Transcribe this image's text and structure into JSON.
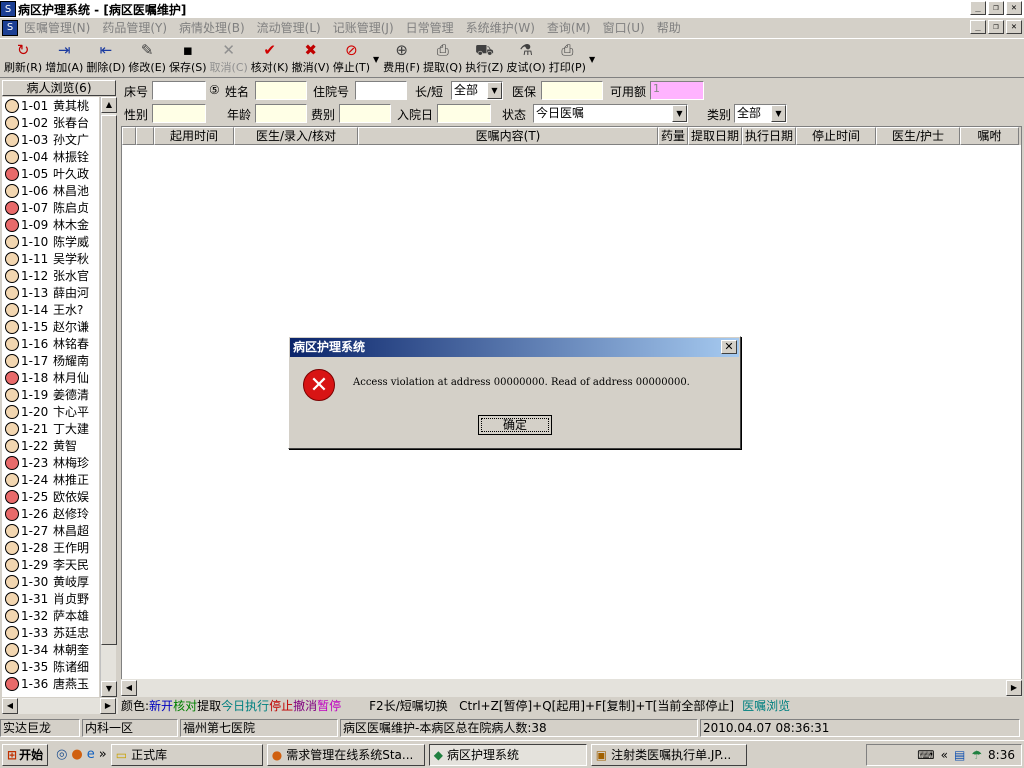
{
  "window": {
    "title": "病区护理系统 - [病区医嘱维护]"
  },
  "menu": [
    "医嘱管理(N)",
    "药品管理(Y)",
    "病情处理(B)",
    "流动管理(L)",
    "记账管理(J)",
    "日常管理",
    "系统维护(W)",
    "查询(M)",
    "窗口(U)",
    "帮助"
  ],
  "toolbar": [
    {
      "label": "刷新(R)",
      "icon": "refresh-icon",
      "glyph": "↻",
      "color": "#c00000",
      "disabled": false
    },
    {
      "label": "增加(A)",
      "icon": "add-icon",
      "glyph": "⇥",
      "color": "#1a3aa0",
      "disabled": false
    },
    {
      "label": "删除(D)",
      "icon": "delete-icon",
      "glyph": "⇤",
      "color": "#1a3aa0",
      "disabled": false
    },
    {
      "label": "修改(E)",
      "icon": "edit-icon",
      "glyph": "✎",
      "color": "#404040",
      "disabled": false
    },
    {
      "label": "保存(S)",
      "icon": "save-icon",
      "glyph": "▪",
      "color": "#000000",
      "disabled": false
    },
    {
      "label": "取消(C)",
      "icon": "cancel-icon",
      "glyph": "✕",
      "color": "#909090",
      "disabled": true
    },
    {
      "label": "核对(K)",
      "icon": "check-icon",
      "glyph": "✔",
      "color": "#d00000",
      "disabled": false
    },
    {
      "label": "撤消(V)",
      "icon": "undo-icon",
      "glyph": "✖",
      "color": "#c00000",
      "disabled": false
    },
    {
      "label": "停止(T)",
      "icon": "stop-icon",
      "glyph": "⊘",
      "color": "#d00000",
      "disabled": false
    },
    {
      "label": "费用(F)",
      "icon": "fee-icon",
      "glyph": "⊕",
      "color": "#404040",
      "disabled": false
    },
    {
      "label": "提取(Q)",
      "icon": "extract-icon",
      "glyph": "⎙",
      "color": "#404040",
      "disabled": false
    },
    {
      "label": "执行(Z)",
      "icon": "execute-icon",
      "glyph": "⛟",
      "color": "#404040",
      "disabled": false
    },
    {
      "label": "皮试(O)",
      "icon": "skin-test-icon",
      "glyph": "⚗",
      "color": "#404040",
      "disabled": false
    },
    {
      "label": "打印(P)",
      "icon": "print-icon",
      "glyph": "⎙",
      "color": "#404040",
      "disabled": false
    }
  ],
  "sidebar": {
    "title": "病人浏览(6)",
    "patients": [
      {
        "bed": "1-01",
        "name": "黄其桃",
        "female": false
      },
      {
        "bed": "1-02",
        "name": "张春台",
        "female": false
      },
      {
        "bed": "1-03",
        "name": "孙文广",
        "female": false
      },
      {
        "bed": "1-04",
        "name": "林振铨",
        "female": false
      },
      {
        "bed": "1-05",
        "name": "叶久政",
        "female": true
      },
      {
        "bed": "1-06",
        "name": "林昌池",
        "female": false
      },
      {
        "bed": "1-07",
        "name": "陈启贞",
        "female": true
      },
      {
        "bed": "1-09",
        "name": "林木金",
        "female": true
      },
      {
        "bed": "1-10",
        "name": "陈学威",
        "female": false
      },
      {
        "bed": "1-11",
        "name": "吴学秋",
        "female": false
      },
      {
        "bed": "1-12",
        "name": "张水官",
        "female": false
      },
      {
        "bed": "1-13",
        "name": "薛由河",
        "female": false
      },
      {
        "bed": "1-14",
        "name": "王水?",
        "female": false
      },
      {
        "bed": "1-15",
        "name": "赵尔谦",
        "female": false
      },
      {
        "bed": "1-16",
        "name": "林铭春",
        "female": false
      },
      {
        "bed": "1-17",
        "name": "杨耀南",
        "female": false
      },
      {
        "bed": "1-18",
        "name": "林月仙",
        "female": true
      },
      {
        "bed": "1-19",
        "name": "姜德清",
        "female": false
      },
      {
        "bed": "1-20",
        "name": "卞心平",
        "female": false
      },
      {
        "bed": "1-21",
        "name": "丁大建",
        "female": false
      },
      {
        "bed": "1-22",
        "name": "黄智",
        "female": false
      },
      {
        "bed": "1-23",
        "name": "林梅珍",
        "female": true
      },
      {
        "bed": "1-24",
        "name": "林推正",
        "female": false
      },
      {
        "bed": "1-25",
        "name": "欧依娱",
        "female": true
      },
      {
        "bed": "1-26",
        "name": "赵修玲",
        "female": true
      },
      {
        "bed": "1-27",
        "name": "林昌超",
        "female": false
      },
      {
        "bed": "1-28",
        "name": "王作明",
        "female": false
      },
      {
        "bed": "1-29",
        "name": "李天民",
        "female": false
      },
      {
        "bed": "1-30",
        "name": "黄岐厚",
        "female": false
      },
      {
        "bed": "1-31",
        "name": "肖贞野",
        "female": false
      },
      {
        "bed": "1-32",
        "name": "萨本雄",
        "female": false
      },
      {
        "bed": "1-33",
        "name": "苏廷忠",
        "female": false
      },
      {
        "bed": "1-34",
        "name": "林朝奎",
        "female": false
      },
      {
        "bed": "1-35",
        "name": "陈诸细",
        "female": false
      },
      {
        "bed": "1-36",
        "name": "唐燕玉",
        "female": true
      }
    ]
  },
  "form": {
    "bed_label": "床号",
    "num_badge": "⑤",
    "name_label": "姓名",
    "admission_no_label": "住院号",
    "long_short_label": "长/短",
    "long_short_value": "全部",
    "insurance_label": "医保",
    "available_label": "可用额",
    "available_value": "1",
    "gender_label": "性别",
    "age_label": "年龄",
    "fee_label": "费别",
    "admit_date_label": "入院日",
    "status_label": "状态",
    "status_value": "今日医嘱",
    "category_label": "类别",
    "category_value": "全部"
  },
  "grid": {
    "columns": [
      "起用时间",
      "医生/录入/核对",
      "医嘱内容(T)",
      "药量",
      "提取日期",
      "执行日期",
      "停止时间",
      "医生/护士",
      "嘱咐"
    ]
  },
  "legend": {
    "prefix": "颜色:",
    "items": [
      {
        "text": "新开",
        "color": "#0000c0"
      },
      {
        "text": "核对",
        "color": "#008000"
      },
      {
        "text": "提取",
        "color": "#000000"
      },
      {
        "text": "今日执行",
        "color": "#008080"
      },
      {
        "text": "停止",
        "color": "#c00000"
      },
      {
        "text": "撤消",
        "color": "#800080"
      },
      {
        "text": "暂停",
        "color": "#c000c0"
      }
    ],
    "hint": "F2长/短嘱切换   Ctrl+Z[暂停]+Q[起用]+F[复制]+T[当前全部停止]",
    "link": "医嘱浏览"
  },
  "status": {
    "company": "实达巨龙",
    "department": "内科一区",
    "hospital": "福州第七医院",
    "info": "病区医嘱维护-本病区总在院病人数:38",
    "datetime": "2010.04.07 08:36:31"
  },
  "taskbar": {
    "start": "开始",
    "items": [
      "正式库",
      "需求管理在线系统Sta...",
      "病区护理系统",
      "注射类医嘱执行单.JP..."
    ],
    "time": "8:36"
  },
  "dialog": {
    "title": "病区护理系统",
    "message": "Access violation at address 00000000. Read of address 00000000.",
    "ok": "确定"
  }
}
